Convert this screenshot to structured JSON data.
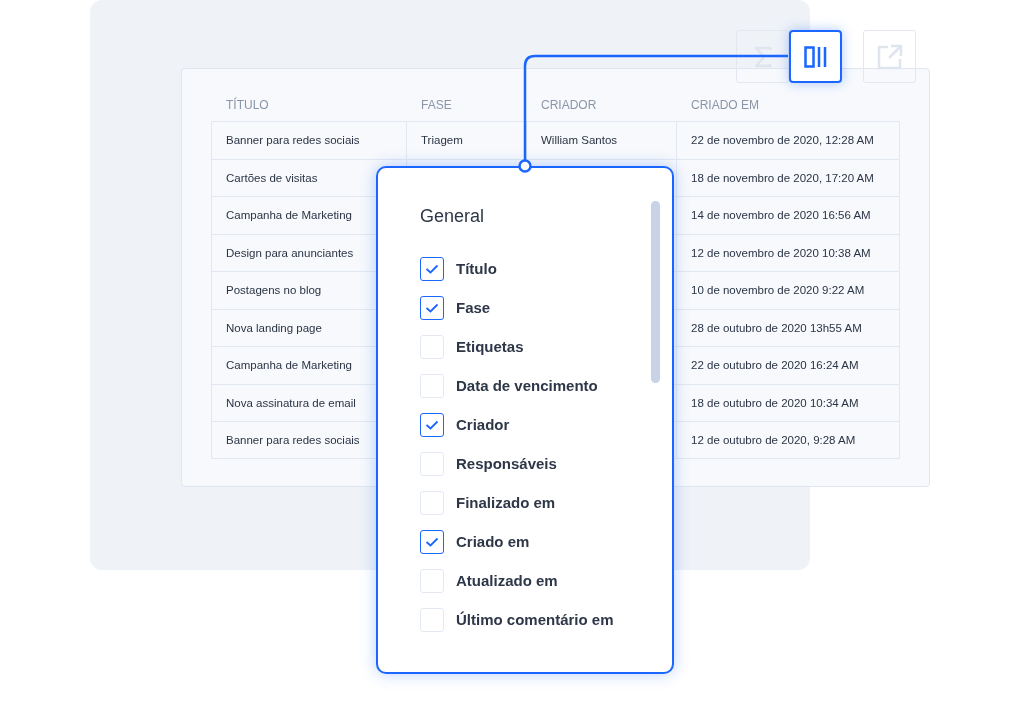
{
  "toolbar": [
    {
      "kind": "sum",
      "selected": false
    },
    {
      "kind": "columns",
      "selected": true
    },
    {
      "kind": "export",
      "selected": false
    }
  ],
  "table": {
    "columns": [
      "TÍTULO",
      "FASE",
      "CRIADOR",
      "CRIADO EM"
    ],
    "rows": [
      {
        "titulo": "Banner para redes sociais",
        "fase": "Triagem",
        "criador": "William Santos",
        "criado_em": "22 de novembro de 2020, 12:28 AM"
      },
      {
        "titulo": "Cartões de visitas",
        "criado_em": "18 de novembro de 2020, 17:20 AM"
      },
      {
        "titulo": "Campanha de Marketing",
        "criado_em": "14 de novembro de 2020 16:56 AM"
      },
      {
        "titulo": "Design para anunciantes",
        "criado_em": "12 de novembro de 2020 10:38 AM"
      },
      {
        "titulo": "Postagens no blog",
        "criado_em": "10 de novembro de 2020 9:22 AM"
      },
      {
        "titulo": "Nova landing page",
        "criado_em": "28 de outubro de 2020 13h55 AM"
      },
      {
        "titulo": "Campanha de Marketing",
        "criado_em": "22 de outubro de 2020 16:24 AM"
      },
      {
        "titulo": "Nova assinatura de email",
        "criado_em": "18 de outubro de 2020 10:34 AM"
      },
      {
        "titulo": "Banner para redes sociais",
        "criado_em": "12 de outubro de 2020, 9:28 AM"
      }
    ]
  },
  "column_menu": {
    "title": "General",
    "options": [
      {
        "label": "Título",
        "checked": true
      },
      {
        "label": "Fase",
        "checked": true
      },
      {
        "label": "Etiquetas",
        "checked": false
      },
      {
        "label": "Data de vencimento",
        "checked": false
      },
      {
        "label": "Criador",
        "checked": true
      },
      {
        "label": "Responsáveis",
        "checked": false
      },
      {
        "label": "Finalizado em",
        "checked": false
      },
      {
        "label": "Criado em",
        "checked": true
      },
      {
        "label": "Atualizado em",
        "checked": false
      },
      {
        "label": "Último comentário em",
        "checked": false
      }
    ]
  }
}
